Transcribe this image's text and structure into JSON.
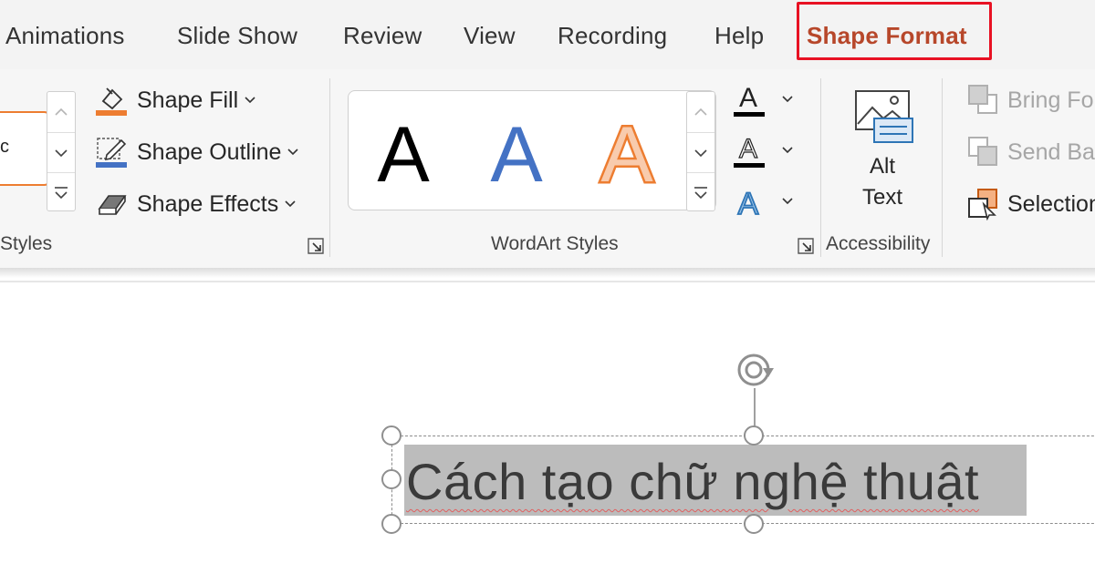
{
  "tabs": [
    {
      "label": "Animations"
    },
    {
      "label": "Slide Show"
    },
    {
      "label": "Review"
    },
    {
      "label": "View"
    },
    {
      "label": "Recording"
    },
    {
      "label": "Help"
    },
    {
      "label": "Shape Format",
      "active": true
    }
  ],
  "shape_styles": {
    "preview_text": "c",
    "group_label": "Styles",
    "shape_fill": "Shape Fill",
    "shape_outline": "Shape Outline",
    "shape_effects": "Shape Effects"
  },
  "wordart_styles": {
    "group_label": "WordArt Styles",
    "samples": [
      "A",
      "A",
      "A"
    ],
    "text_fill_glyph": "A",
    "text_outline_glyph": "A",
    "text_effects_glyph": "A"
  },
  "accessibility": {
    "alt_text_line1": "Alt",
    "alt_text_line2": "Text",
    "group_label": "Accessibility"
  },
  "arrange": {
    "bring_forward": "Bring Fo",
    "send_backward": "Send Bac",
    "selection_pane": "Selection"
  },
  "slide": {
    "text": "Cách tạo chữ nghệ thuật"
  },
  "colors": {
    "active_tab": "#b7472a",
    "highlight_box": "#e81123",
    "fill_orange": "#ed7d31",
    "outline_blue": "#4472c4"
  }
}
